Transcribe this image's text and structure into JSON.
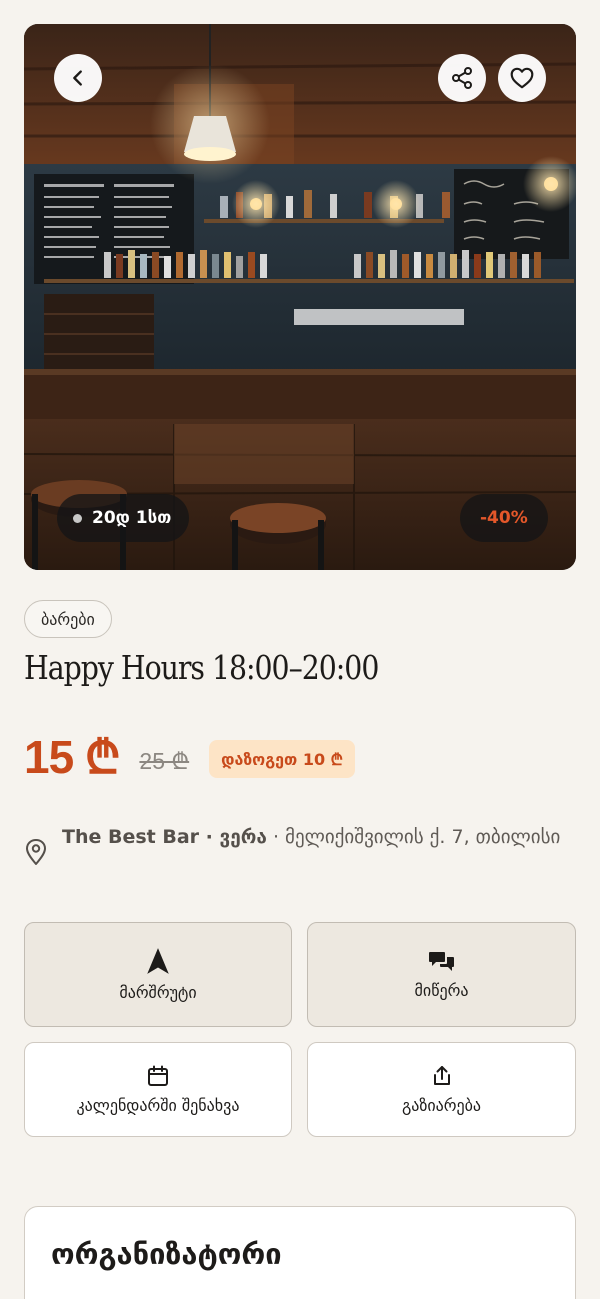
{
  "hero": {
    "time_left": "20დ 1სთ",
    "discount": "-40%"
  },
  "category": "ბარები",
  "title": "Happy Hours 18:00–20:00",
  "price": {
    "current": "15 ₾",
    "old": "25 ₾",
    "save_badge": "დაზოგეთ 10 ₾"
  },
  "location": {
    "venue": "The Best Bar · ვერა",
    "address": " · მელიქიშვილის ქ. 7, თბილისი"
  },
  "actions": {
    "route": "მარშრუტი",
    "message": "მიწერა",
    "calendar": "კალენდარში შენახვა",
    "share": "გაზიარება"
  },
  "organizer": {
    "heading": "ორგანიზატორი"
  },
  "colors": {
    "accent": "#c84a1b",
    "save_badge_bg": "#fde4c6",
    "background": "#f6f3ee"
  },
  "icons": {
    "back": "chevron-left-icon",
    "share": "share-icon",
    "favorite": "heart-icon",
    "location": "map-pin-icon",
    "route": "navigation-arrow-icon",
    "message": "chat-bubbles-icon",
    "calendar": "calendar-icon",
    "share_action": "upload-share-icon"
  }
}
